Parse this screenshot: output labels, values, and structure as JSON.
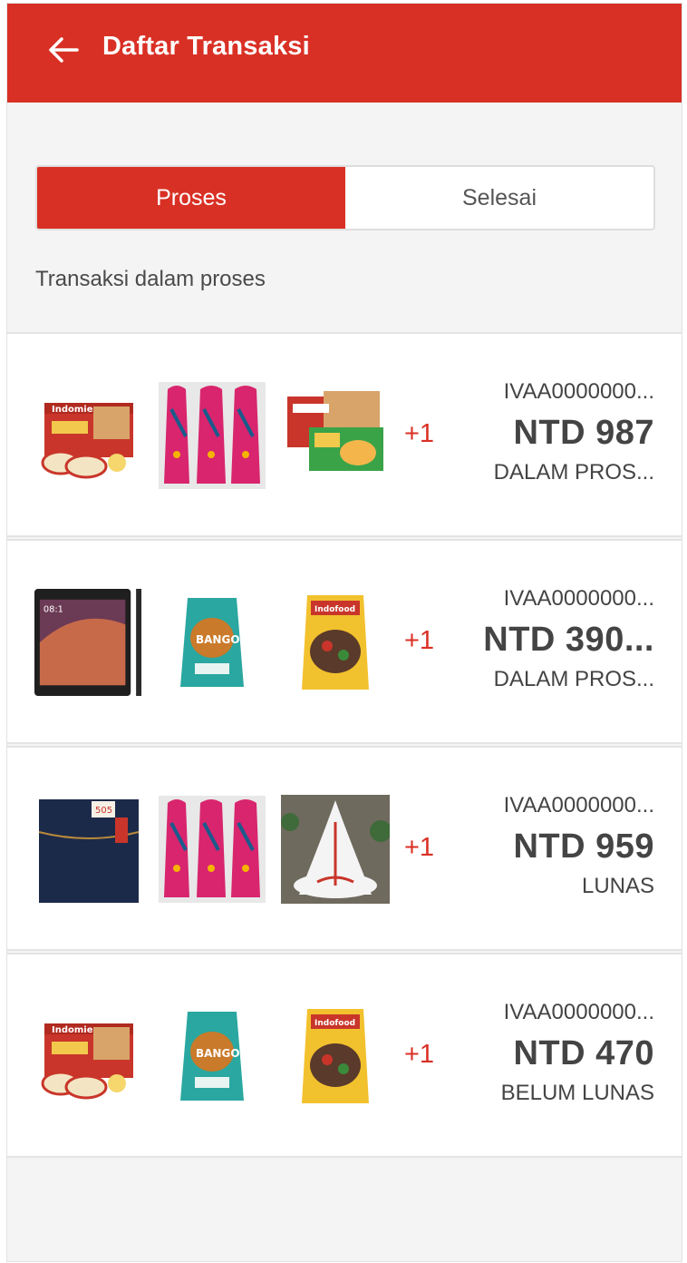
{
  "header": {
    "title": "Daftar Transaksi"
  },
  "tabs": [
    {
      "label": "Proses",
      "active": true
    },
    {
      "label": "Selesai",
      "active": false
    }
  ],
  "section_label": "Transaksi dalam proses",
  "transactions": [
    {
      "code": "IVAA0000000...",
      "price": "NTD 987",
      "status": "DALAM PROS...",
      "more": "+1",
      "thumbs": [
        "indomie-goreng-box",
        "pink-batik-dress",
        "indomie-soto-box"
      ]
    },
    {
      "code": "IVAA0000000...",
      "price": "NTD 390...",
      "status": "DALAM PROS...",
      "more": "+1",
      "thumbs": [
        "smartphone",
        "bango-soy-sauce-pouch",
        "indofood-soy-sauce-pouch"
      ]
    },
    {
      "code": "IVAA0000000...",
      "price": "NTD 959",
      "status": "LUNAS",
      "more": "+1",
      "thumbs": [
        "denim-jeans",
        "pink-batik-dress",
        "white-embroidered-gown"
      ]
    },
    {
      "code": "IVAA0000000...",
      "price": "NTD 470",
      "status": "BELUM LUNAS",
      "more": "+1",
      "thumbs": [
        "indomie-goreng-box",
        "bango-soy-sauce-pouch",
        "indofood-soy-sauce-pouch"
      ]
    }
  ],
  "colors": {
    "brand": "#d93025",
    "background": "#f4f4f4",
    "text": "#444444"
  }
}
